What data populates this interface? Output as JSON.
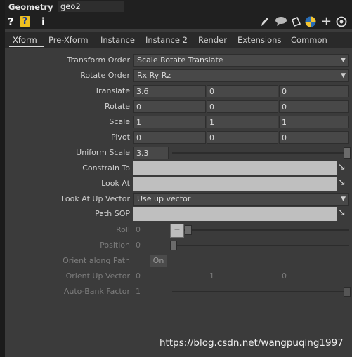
{
  "title": {
    "op_type": "Geometry",
    "op_name": "geo2"
  },
  "toolbar": {
    "help": "?",
    "help_box": "?",
    "info": "i",
    "icons": [
      "pencil-icon",
      "comment-icon",
      "bookmark-icon",
      "python-icon",
      "plus-icon",
      "target-icon"
    ]
  },
  "tabs": [
    "Xform",
    "Pre-Xform",
    "Instance",
    "Instance 2",
    "Render",
    "Extensions",
    "Common"
  ],
  "params": {
    "transform_order": {
      "label": "Transform Order",
      "value": "Scale Rotate Translate"
    },
    "rotate_order": {
      "label": "Rotate Order",
      "value": "Rx Ry Rz"
    },
    "translate": {
      "label": "Translate",
      "x": "3.6",
      "y": "0",
      "z": "0"
    },
    "rotate": {
      "label": "Rotate",
      "x": "0",
      "y": "0",
      "z": "0"
    },
    "scale": {
      "label": "Scale",
      "x": "1",
      "y": "1",
      "z": "1"
    },
    "pivot": {
      "label": "Pivot",
      "x": "0",
      "y": "0",
      "z": "0"
    },
    "uniform_scale": {
      "label": "Uniform Scale",
      "value": "3.3"
    },
    "constrain_to": {
      "label": "Constrain To",
      "value": ""
    },
    "look_at": {
      "label": "Look At",
      "value": ""
    },
    "look_at_up": {
      "label": "Look At Up Vector",
      "value": "Use up vector"
    },
    "path_sop": {
      "label": "Path SOP",
      "value": ""
    },
    "roll": {
      "label": "Roll",
      "value": "0"
    },
    "position": {
      "label": "Position",
      "value": "0"
    },
    "orient_along_path": {
      "label": "Orient along Path",
      "value": "On"
    },
    "orient_up_vector": {
      "label": "Orient Up Vector",
      "x": "0",
      "y": "1",
      "z": "0"
    },
    "auto_bank": {
      "label": "Auto-Bank Factor",
      "value": "1"
    }
  },
  "watermark": "https://blog.csdn.net/wangpuqing1997"
}
